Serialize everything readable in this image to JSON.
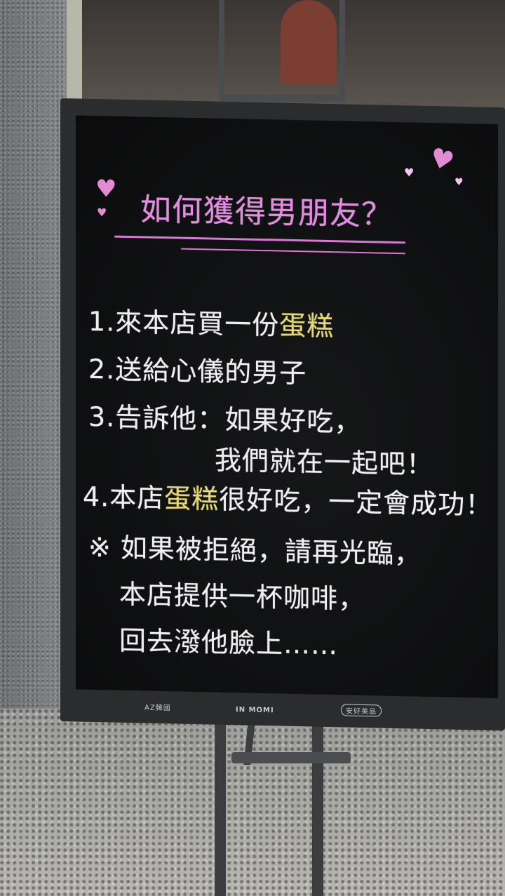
{
  "board": {
    "title": "如何獲得男朋友？",
    "line1_prefix": "1.來本店買一份",
    "line1_highlight": "蛋糕",
    "line2": "2.送給心儀的男子",
    "line3a": "3.告訴他：如果好吃，",
    "line3b": "我們就在一起吧！",
    "line4_prefix": "4.本店",
    "line4_highlight": "蛋糕",
    "line4_suffix": "很好吃，一定會成功！",
    "note1": "※ 如果被拒絕，請再光臨，",
    "note2": "本店提供一杯咖啡，",
    "note3": "回去潑他臉上……",
    "brand_left": "AZ韓國",
    "brand_center": "IN MOMI",
    "brand_right": "安好美品"
  },
  "colors": {
    "title": "#e58ae3",
    "highlight": "#e6d86e",
    "chalk": "#f1eef3",
    "board": "#0e0f10"
  },
  "icons": [
    "heart-icon"
  ]
}
